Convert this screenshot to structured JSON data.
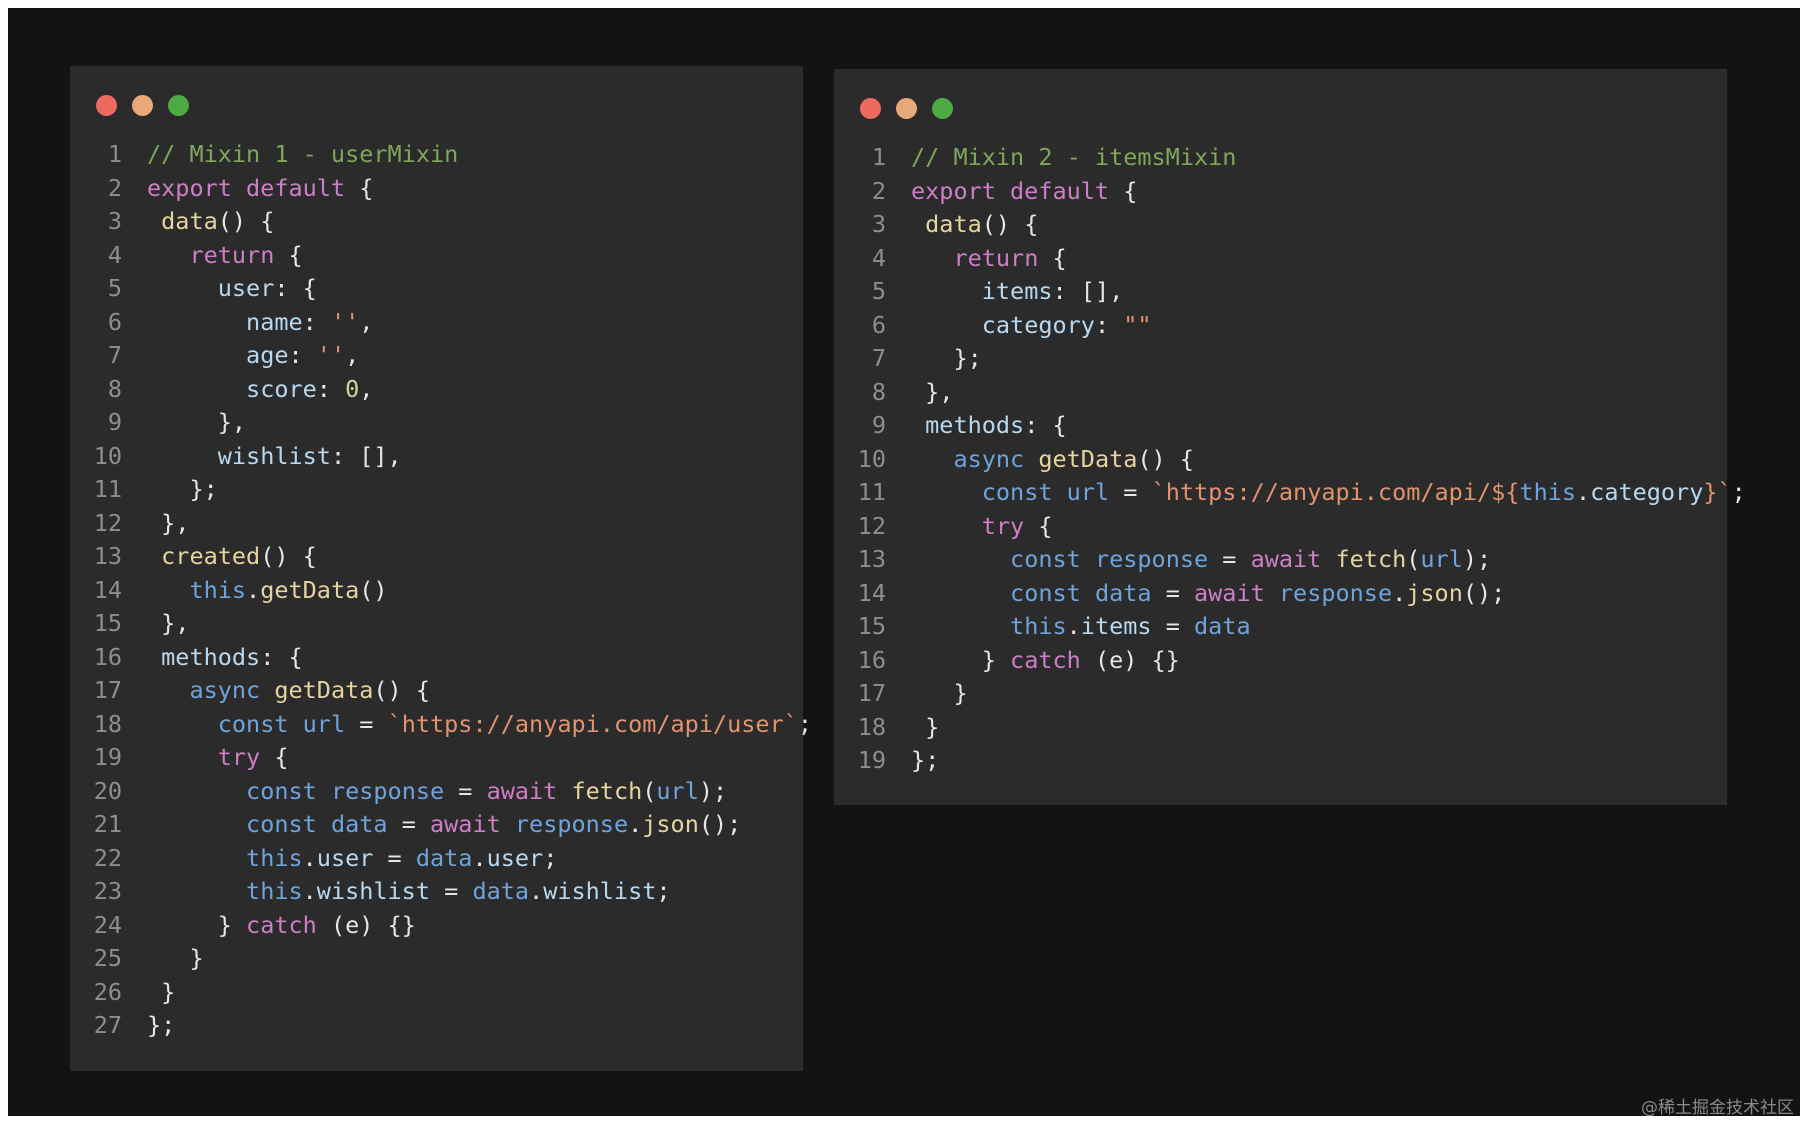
{
  "colors": {
    "background": "#131313",
    "panel": "#2b2b2b",
    "line_number": "#8e8e8e",
    "dot_close": "#ec6a5e",
    "dot_minimize": "#e8a878",
    "dot_zoom": "#4eaa43",
    "syntax": {
      "c": "#7fa65a",
      "k": "#cc7ec7",
      "b": "#6fa3dc",
      "s": "#e1926e",
      "n": "#c6dc9c",
      "f": "#e6d4a0",
      "p": "#e6e6e6",
      "i": "#b8d8f0"
    }
  },
  "windows": [
    {
      "id": "win1",
      "name": "code-window-usermixin",
      "lines": [
        [
          [
            "c",
            "// Mixin 1 - userMixin"
          ]
        ],
        [
          [
            "k",
            "export default"
          ],
          [
            "p",
            " {"
          ]
        ],
        [
          [
            "p",
            " "
          ],
          [
            "f",
            "data"
          ],
          [
            "p",
            "() {"
          ]
        ],
        [
          [
            "p",
            "   "
          ],
          [
            "k",
            "return"
          ],
          [
            "p",
            " {"
          ]
        ],
        [
          [
            "p",
            "     "
          ],
          [
            "i",
            "user"
          ],
          [
            "p",
            ": {"
          ]
        ],
        [
          [
            "p",
            "       "
          ],
          [
            "i",
            "name"
          ],
          [
            "p",
            ": "
          ],
          [
            "s",
            "''"
          ],
          [
            "p",
            ","
          ]
        ],
        [
          [
            "p",
            "       "
          ],
          [
            "i",
            "age"
          ],
          [
            "p",
            ": "
          ],
          [
            "s",
            "''"
          ],
          [
            "p",
            ","
          ]
        ],
        [
          [
            "p",
            "       "
          ],
          [
            "i",
            "score"
          ],
          [
            "p",
            ": "
          ],
          [
            "n",
            "0"
          ],
          [
            "p",
            ","
          ]
        ],
        [
          [
            "p",
            "     },"
          ]
        ],
        [
          [
            "p",
            "     "
          ],
          [
            "i",
            "wishlist"
          ],
          [
            "p",
            ": [],"
          ]
        ],
        [
          [
            "p",
            "   };"
          ]
        ],
        [
          [
            "p",
            " },"
          ]
        ],
        [
          [
            "p",
            " "
          ],
          [
            "f",
            "created"
          ],
          [
            "p",
            "() {"
          ]
        ],
        [
          [
            "p",
            "   "
          ],
          [
            "b",
            "this"
          ],
          [
            "p",
            "."
          ],
          [
            "f",
            "getData"
          ],
          [
            "p",
            "()"
          ]
        ],
        [
          [
            "p",
            " },"
          ]
        ],
        [
          [
            "p",
            " "
          ],
          [
            "i",
            "methods"
          ],
          [
            "p",
            ": {"
          ]
        ],
        [
          [
            "p",
            "   "
          ],
          [
            "b",
            "async"
          ],
          [
            "p",
            " "
          ],
          [
            "f",
            "getData"
          ],
          [
            "p",
            "() {"
          ]
        ],
        [
          [
            "p",
            "     "
          ],
          [
            "b",
            "const"
          ],
          [
            "p",
            " "
          ],
          [
            "b",
            "url"
          ],
          [
            "p",
            " = "
          ],
          [
            "s",
            "`https://anyapi.com/api/user`"
          ],
          [
            "p",
            ";"
          ]
        ],
        [
          [
            "p",
            "     "
          ],
          [
            "k",
            "try"
          ],
          [
            "p",
            " {"
          ]
        ],
        [
          [
            "p",
            "       "
          ],
          [
            "b",
            "const"
          ],
          [
            "p",
            " "
          ],
          [
            "b",
            "response"
          ],
          [
            "p",
            " = "
          ],
          [
            "k",
            "await"
          ],
          [
            "p",
            " "
          ],
          [
            "f",
            "fetch"
          ],
          [
            "p",
            "("
          ],
          [
            "b",
            "url"
          ],
          [
            "p",
            ");"
          ]
        ],
        [
          [
            "p",
            "       "
          ],
          [
            "b",
            "const"
          ],
          [
            "p",
            " "
          ],
          [
            "b",
            "data"
          ],
          [
            "p",
            " = "
          ],
          [
            "k",
            "await"
          ],
          [
            "p",
            " "
          ],
          [
            "b",
            "response"
          ],
          [
            "p",
            "."
          ],
          [
            "f",
            "json"
          ],
          [
            "p",
            "();"
          ]
        ],
        [
          [
            "p",
            "       "
          ],
          [
            "b",
            "this"
          ],
          [
            "p",
            "."
          ],
          [
            "i",
            "user"
          ],
          [
            "p",
            " = "
          ],
          [
            "b",
            "data"
          ],
          [
            "p",
            "."
          ],
          [
            "i",
            "user"
          ],
          [
            "p",
            ";"
          ]
        ],
        [
          [
            "p",
            "       "
          ],
          [
            "b",
            "this"
          ],
          [
            "p",
            "."
          ],
          [
            "i",
            "wishlist"
          ],
          [
            "p",
            " = "
          ],
          [
            "b",
            "data"
          ],
          [
            "p",
            "."
          ],
          [
            "i",
            "wishlist"
          ],
          [
            "p",
            ";"
          ]
        ],
        [
          [
            "p",
            "     } "
          ],
          [
            "k",
            "catch"
          ],
          [
            "p",
            " (e) {}"
          ]
        ],
        [
          [
            "p",
            "   }"
          ]
        ],
        [
          [
            "p",
            " }"
          ]
        ],
        [
          [
            "p",
            "};"
          ]
        ]
      ]
    },
    {
      "id": "win2",
      "name": "code-window-itemsmixin",
      "lines": [
        [
          [
            "c",
            "// Mixin 2 - itemsMixin"
          ]
        ],
        [
          [
            "k",
            "export default"
          ],
          [
            "p",
            " {"
          ]
        ],
        [
          [
            "p",
            " "
          ],
          [
            "f",
            "data"
          ],
          [
            "p",
            "() {"
          ]
        ],
        [
          [
            "p",
            "   "
          ],
          [
            "k",
            "return"
          ],
          [
            "p",
            " {"
          ]
        ],
        [
          [
            "p",
            "     "
          ],
          [
            "i",
            "items"
          ],
          [
            "p",
            ": [],"
          ]
        ],
        [
          [
            "p",
            "     "
          ],
          [
            "i",
            "category"
          ],
          [
            "p",
            ": "
          ],
          [
            "s",
            "\"\""
          ]
        ],
        [
          [
            "p",
            "   };"
          ]
        ],
        [
          [
            "p",
            " },"
          ]
        ],
        [
          [
            "p",
            " "
          ],
          [
            "i",
            "methods"
          ],
          [
            "p",
            ": {"
          ]
        ],
        [
          [
            "p",
            "   "
          ],
          [
            "b",
            "async"
          ],
          [
            "p",
            " "
          ],
          [
            "f",
            "getData"
          ],
          [
            "p",
            "() {"
          ]
        ],
        [
          [
            "p",
            "     "
          ],
          [
            "b",
            "const"
          ],
          [
            "p",
            " "
          ],
          [
            "b",
            "url"
          ],
          [
            "p",
            " = "
          ],
          [
            "s",
            "`https://anyapi.com/api/${"
          ],
          [
            "b",
            "this"
          ],
          [
            "p",
            "."
          ],
          [
            "i",
            "category"
          ],
          [
            "s",
            "}`"
          ],
          [
            "p",
            ";"
          ]
        ],
        [
          [
            "p",
            "     "
          ],
          [
            "k",
            "try"
          ],
          [
            "p",
            " {"
          ]
        ],
        [
          [
            "p",
            "       "
          ],
          [
            "b",
            "const"
          ],
          [
            "p",
            " "
          ],
          [
            "b",
            "response"
          ],
          [
            "p",
            " = "
          ],
          [
            "k",
            "await"
          ],
          [
            "p",
            " "
          ],
          [
            "f",
            "fetch"
          ],
          [
            "p",
            "("
          ],
          [
            "b",
            "url"
          ],
          [
            "p",
            ");"
          ]
        ],
        [
          [
            "p",
            "       "
          ],
          [
            "b",
            "const"
          ],
          [
            "p",
            " "
          ],
          [
            "b",
            "data"
          ],
          [
            "p",
            " = "
          ],
          [
            "k",
            "await"
          ],
          [
            "p",
            " "
          ],
          [
            "b",
            "response"
          ],
          [
            "p",
            "."
          ],
          [
            "f",
            "json"
          ],
          [
            "p",
            "();"
          ]
        ],
        [
          [
            "p",
            "       "
          ],
          [
            "b",
            "this"
          ],
          [
            "p",
            "."
          ],
          [
            "i",
            "items"
          ],
          [
            "p",
            " = "
          ],
          [
            "b",
            "data"
          ]
        ],
        [
          [
            "p",
            "     } "
          ],
          [
            "k",
            "catch"
          ],
          [
            "p",
            " (e) {}"
          ]
        ],
        [
          [
            "p",
            "   }"
          ]
        ],
        [
          [
            "p",
            " }"
          ]
        ],
        [
          [
            "p",
            "};"
          ]
        ]
      ]
    }
  ],
  "watermark": "@稀土掘金技术社区"
}
